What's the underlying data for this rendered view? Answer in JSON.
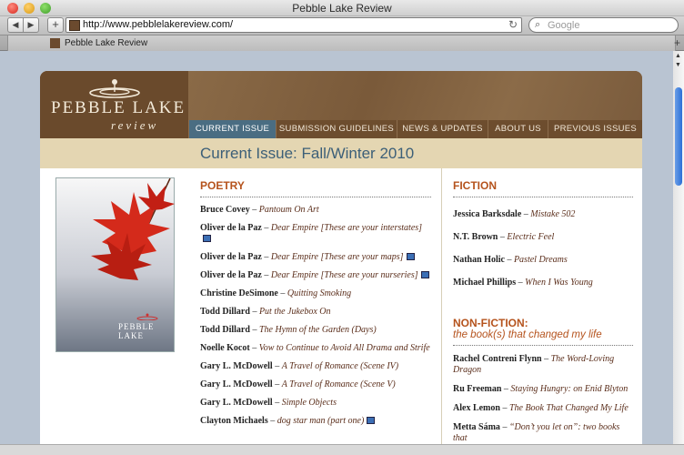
{
  "browser": {
    "window_title": "Pebble Lake Review",
    "url": "http://www.pebblelakereview.com/",
    "search_placeholder": "Google",
    "tab_label": "Pebble Lake Review"
  },
  "site": {
    "logo_line1": "PEBBLE LAKE",
    "logo_line2": "review",
    "nav": [
      "CURRENT ISSUE",
      "SUBMISSION GUIDELINES",
      "NEWS & UPDATES",
      "ABOUT US",
      "PREVIOUS ISSUES"
    ],
    "issue_title": "Current Issue: Fall/Winter 2010",
    "cover_text": "PEBBLE LAKE"
  },
  "poetry": {
    "heading": "POETRY",
    "entries": [
      {
        "author": "Bruce Covey",
        "title": "Pantoum On Art",
        "audio": false
      },
      {
        "author": "Oliver de la Paz",
        "title": "Dear Empire",
        "note": "[These are your interstates]",
        "audio": true
      },
      {
        "author": "Oliver de la Paz",
        "title": "Dear Empire",
        "note": "[These are your maps]",
        "audio": true
      },
      {
        "author": "Oliver de la Paz",
        "title": "Dear Empire",
        "note": "[These are your nurseries]",
        "audio": true
      },
      {
        "author": "Christine DeSimone",
        "title": "Quitting Smoking",
        "audio": false
      },
      {
        "author": "Todd Dillard",
        "title": "Put the Jukebox On",
        "audio": false
      },
      {
        "author": "Todd Dillard",
        "title": "The Hymn of the Garden (Days)",
        "audio": false
      },
      {
        "author": "Noelle Kocot",
        "title": "Vow to Continue to Avoid All Drama and Strife",
        "audio": false
      },
      {
        "author": "Gary L. McDowell",
        "title": "A Travel of Romance (Scene IV)",
        "audio": false
      },
      {
        "author": "Gary L. McDowell",
        "title": "A Travel of Romance (Scene V)",
        "audio": false
      },
      {
        "author": "Gary L. McDowell",
        "title": "Simple Objects",
        "audio": false
      },
      {
        "author": "Clayton Michaels",
        "title": "dog star man (part one)",
        "audio": true
      }
    ]
  },
  "fiction": {
    "heading": "FICTION",
    "entries": [
      {
        "author": "Jessica Barksdale",
        "title": "Mistake 502"
      },
      {
        "author": "N.T. Brown",
        "title": "Electric Feel"
      },
      {
        "author": "Nathan Holic",
        "title": "Pastel Dreams"
      },
      {
        "author": "Michael Phillips",
        "title": "When I Was Young"
      }
    ]
  },
  "nonfiction": {
    "heading": "NON-FICTION:",
    "subheading": "the book(s) that changed my life",
    "entries": [
      {
        "author": "Rachel Contreni Flynn",
        "title": "The Word-Loving Dragon"
      },
      {
        "author": "Ru Freeman",
        "title": "Staying Hungry: on Enid Blyton"
      },
      {
        "author": "Alex Lemon",
        "title": "The Book That Changed My Life"
      },
      {
        "author": "Metta Sáma",
        "title": "“Don’t you let on”: two books that"
      }
    ]
  },
  "sep": " – ",
  "colors": {
    "accent": "#b5531d",
    "header_brown": "#6b4a2e",
    "nav_active": "#4a6d82",
    "issue_band": "#e4d6b2"
  }
}
